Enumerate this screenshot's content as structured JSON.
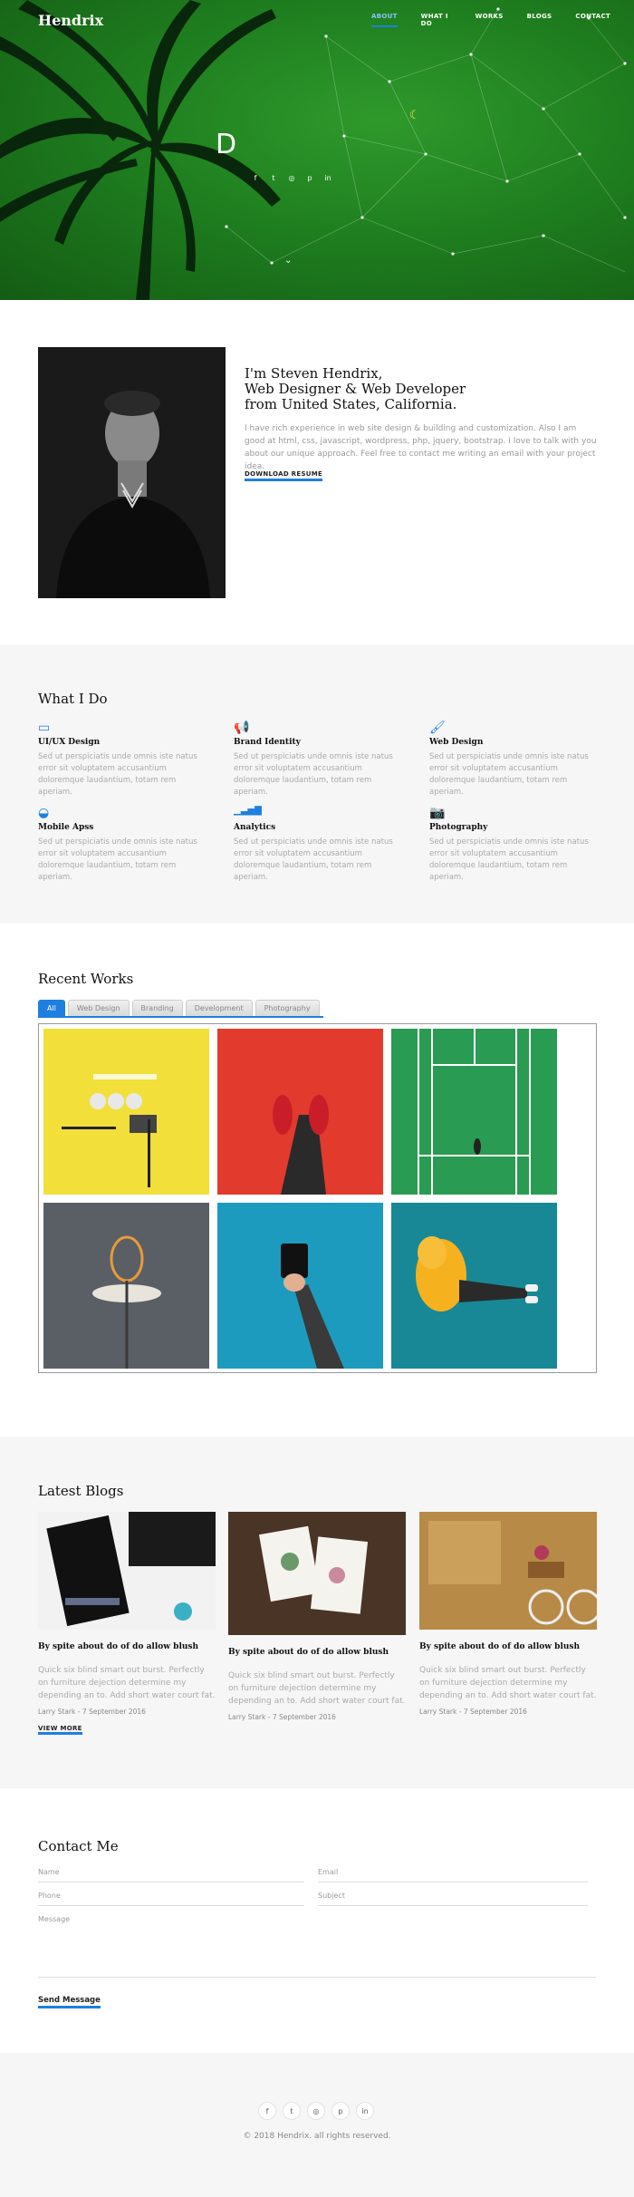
{
  "header": {
    "brand": "Hendrix",
    "nav": [
      {
        "label": "ABOUT",
        "active": true
      },
      {
        "label": "WHAT I DO",
        "active": false
      },
      {
        "label": "WORKS",
        "active": false
      },
      {
        "label": "BLOGS",
        "active": false
      },
      {
        "label": "CONTACT",
        "active": false
      }
    ]
  },
  "hero": {
    "typed_letter": "D",
    "social_icons": [
      "facebook-icon",
      "twitter-icon",
      "instagram-icon",
      "pinterest-icon",
      "linkedin-icon"
    ],
    "social_glyphs": [
      "f",
      "t",
      "◎",
      "p",
      "in"
    ],
    "scroll_glyph": "⌄",
    "moon_glyph": "☾"
  },
  "about": {
    "title_lines": [
      "I'm Steven Hendrix,",
      "Web Designer & Web Developer",
      "from United States, California."
    ],
    "text": "I have rich experience in web site design & building and customization. Also I am good at html, css, javascript, wordpress, php, jquery, bootstrap. I love to talk with you about our unique approach. Feel free to contact me writing an email with your project idea.",
    "download_label": "DOWNLOAD RESUME"
  },
  "services": {
    "title": "What I Do",
    "items": [
      {
        "icon": "laptop-icon",
        "glyph": "▭",
        "name": "UI/UX Design",
        "desc": "Sed ut perspiciatis unde omnis iste natus error sit voluptatem accusantium doloremque laudantium, totam rem aperiam."
      },
      {
        "icon": "megaphone-icon",
        "glyph": "📢",
        "name": "Brand Identity",
        "desc": "Sed ut perspiciatis unde omnis iste natus error sit voluptatem accusantium doloremque laudantium, totam rem aperiam."
      },
      {
        "icon": "paint-brush-icon",
        "glyph": "🖌",
        "name": "Web Design",
        "desc": "Sed ut perspiciatis unde omnis iste natus error sit voluptatem accusantium doloremque laudantium, totam rem aperiam."
      },
      {
        "icon": "android-icon",
        "glyph": "◒",
        "name": "Mobile Apss",
        "desc": "Sed ut perspiciatis unde omnis iste natus error sit voluptatem accusantium doloremque laudantium, totam rem aperiam."
      },
      {
        "icon": "bar-chart-icon",
        "glyph": "▁▃▅▇",
        "name": "Analytics",
        "desc": "Sed ut perspiciatis unde omnis iste natus error sit voluptatem accusantium doloremque laudantium, totam rem aperiam."
      },
      {
        "icon": "camera-icon",
        "glyph": "📷",
        "name": "Photography",
        "desc": "Sed ut perspiciatis unde omnis iste natus error sit voluptatem accusantium doloremque laudantium, totam rem aperiam."
      }
    ]
  },
  "works": {
    "title": "Recent Works",
    "tabs": [
      {
        "label": "All",
        "active": true
      },
      {
        "label": "Web Design",
        "active": false
      },
      {
        "label": "Branding",
        "active": false
      },
      {
        "label": "Development",
        "active": false
      },
      {
        "label": "Photography",
        "active": false
      }
    ],
    "items": [
      {
        "name": "yellow-flatlay",
        "bg": "#f2df3a"
      },
      {
        "name": "red-sneakers",
        "bg": "#e23a2c"
      },
      {
        "name": "tennis-court",
        "bg": "#2a9b52"
      },
      {
        "name": "basketball-hoop",
        "bg": "#5a5f66"
      },
      {
        "name": "coffee-mug",
        "bg": "#1d9bbf"
      },
      {
        "name": "yellow-hoodie",
        "bg": "#188896"
      }
    ]
  },
  "blogs": {
    "title": "Latest Blogs",
    "items": [
      {
        "title": "By spite about do of do allow blush",
        "excerpt": "Quick six blind smart out burst. Perfectly on furniture dejection determine my depending an to. Add short water court fat.",
        "meta": "Larry Stark - 7 September 2016",
        "more": "VIEW MORE"
      },
      {
        "title": "By spite about do of do allow blush",
        "excerpt": "Quick six blind smart out burst. Perfectly on furniture dejection determine my depending an to. Add short water court fat.",
        "meta": "Larry Stark - 7 September 2016",
        "more": ""
      },
      {
        "title": "By spite about do of do allow blush",
        "excerpt": "Quick six blind smart out burst. Perfectly on furniture dejection determine my depending an to. Add short water court fat.",
        "meta": "Larry Stark - 7 September 2016",
        "more": ""
      }
    ]
  },
  "contact": {
    "title": "Contact Me",
    "name_label": "Name",
    "email_label": "Email",
    "phone_label": "Phone",
    "subject_label": "Subject",
    "message_label": "Message",
    "send_label": "Send Message"
  },
  "footer": {
    "social_icons": [
      "facebook-icon",
      "twitter-icon",
      "instagram-icon",
      "pinterest-icon",
      "linkedin-icon"
    ],
    "social_glyphs": [
      "f",
      "t",
      "◎",
      "p",
      "in"
    ],
    "copyright": "© 2018 Hendrix. all rights reserved."
  },
  "colors": {
    "accent": "#1e7fe0",
    "hero_green": "#1f7f1f"
  }
}
